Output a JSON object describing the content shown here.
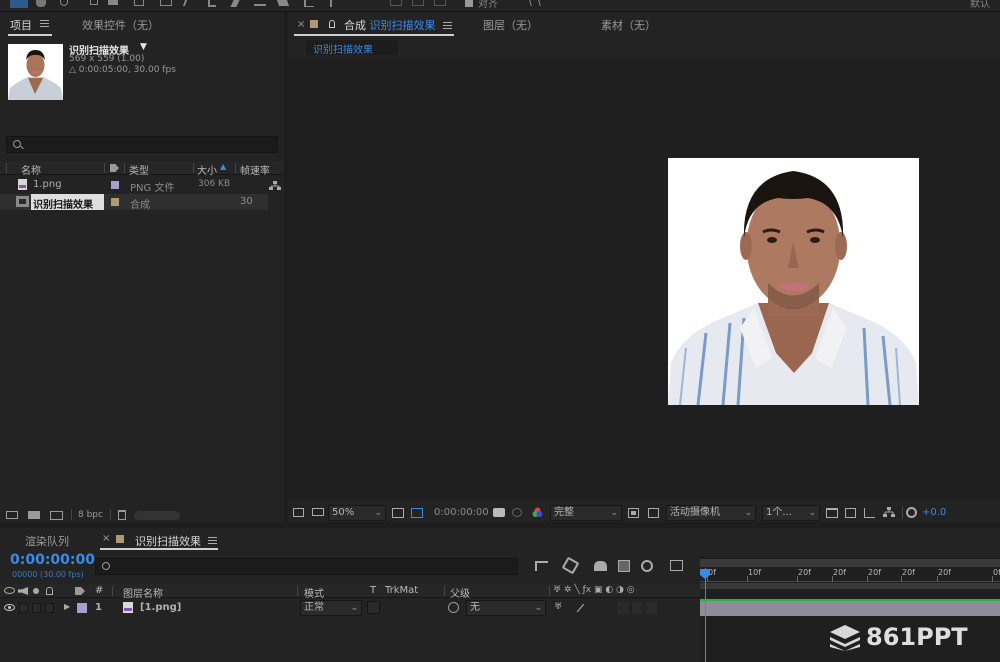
{
  "toolbar": {
    "right_label": "默认",
    "snap_label": "对齐"
  },
  "project_panel": {
    "tab_project": "项目",
    "tab_effects": "效果控件（无）",
    "preview": {
      "name": "识别扫描效果",
      "dimensions": "569 x 559 (1.00)",
      "duration": "△ 0:00:05:00, 30.00 fps"
    },
    "search_placeholder": "",
    "columns": {
      "name": "名称",
      "type": "类型",
      "size": "大小",
      "framerate": "帧速率"
    },
    "items": [
      {
        "name": "1.png",
        "type": "PNG 文件",
        "size": "306 KB",
        "framerate": "",
        "color": "#a89cd0"
      },
      {
        "name": "识别扫描效果",
        "type": "合成",
        "size": "",
        "framerate": "30",
        "color": "#b09a76"
      }
    ],
    "footer": {
      "bpc": "8 bpc"
    }
  },
  "viewer": {
    "tab_comp_prefix": "合成",
    "tab_comp_name": "识别扫描效果",
    "tab_layer": "图层（无）",
    "tab_footage": "素材（无）",
    "breadcrumb": "识别扫描效果",
    "footer": {
      "zoom": "50%",
      "timecode": "0:00:00:00",
      "resolution": "完整",
      "camera": "活动摄像机",
      "views": "1个...",
      "exposure": "+0.0"
    }
  },
  "timeline": {
    "tab_render": "渲染队列",
    "tab_comp": "识别扫描效果",
    "timecode": "0:00:00:00",
    "frame_info": "00000 (30.00 fps)",
    "columns": {
      "hash": "#",
      "layer_name": "图层名称",
      "mode": "模式",
      "t": "T",
      "trkmat": "TrkMat",
      "parent": "父级"
    },
    "layers": [
      {
        "index": "1",
        "name": "[1.png]",
        "mode": "正常",
        "parent": "无",
        "color": "#a89cd0"
      }
    ],
    "ruler_ticks": [
      "0f",
      "10f",
      "20f",
      "20f",
      "20f",
      "20f",
      "20f",
      "0f"
    ]
  },
  "watermark": "861PPT",
  "colors": {
    "accent": "#3a8ae6",
    "panel": "#232323",
    "bg": "#1d1d1d"
  }
}
